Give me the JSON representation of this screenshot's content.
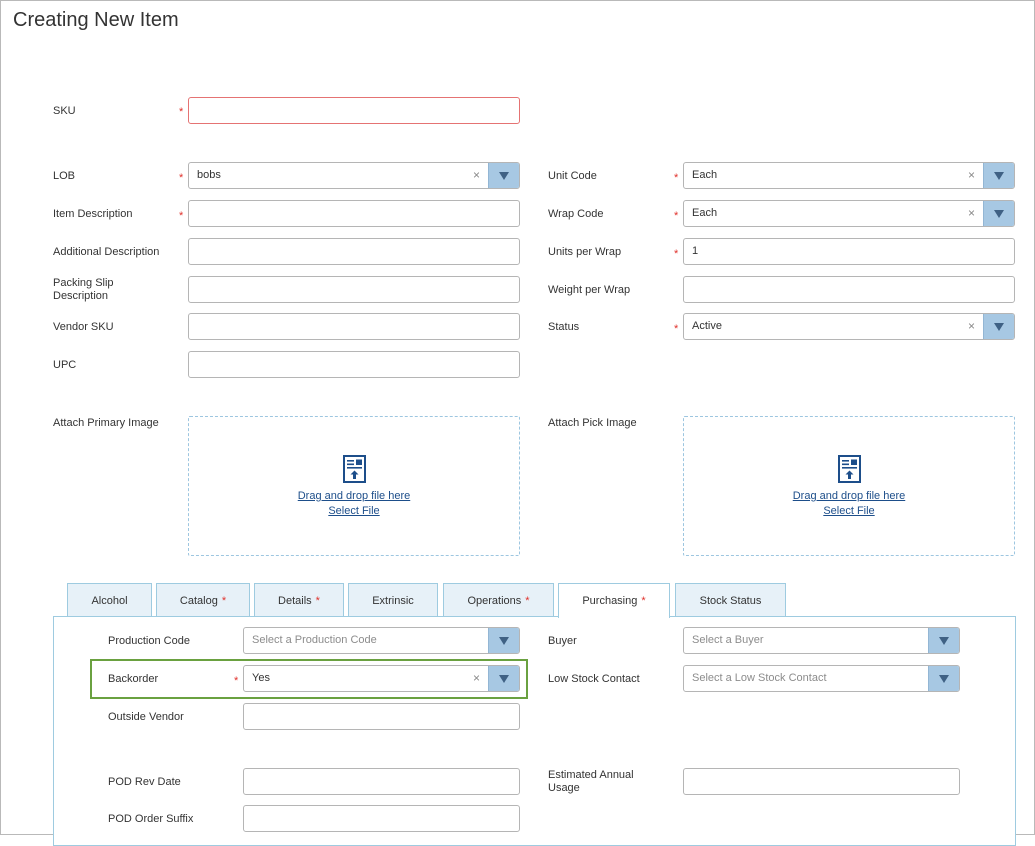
{
  "title": "Creating New Item",
  "form": {
    "sku": {
      "label": "SKU",
      "value": ""
    },
    "lob": {
      "label": "LOB",
      "value": "bobs"
    },
    "item_description": {
      "label": "Item Description",
      "value": ""
    },
    "additional_description": {
      "label": "Additional Description",
      "value": ""
    },
    "packing_slip_description": {
      "label": "Packing Slip Description",
      "value": ""
    },
    "vendor_sku": {
      "label": "Vendor SKU",
      "value": ""
    },
    "upc": {
      "label": "UPC",
      "value": ""
    },
    "unit_code": {
      "label": "Unit Code",
      "value": "Each"
    },
    "wrap_code": {
      "label": "Wrap Code",
      "value": "Each"
    },
    "units_per_wrap": {
      "label": "Units per Wrap",
      "value": "1"
    },
    "weight_per_wrap": {
      "label": "Weight per Wrap",
      "value": ""
    },
    "status": {
      "label": "Status",
      "value": "Active"
    }
  },
  "attach": {
    "primary_label": "Attach Primary Image",
    "pick_label": "Attach Pick Image",
    "drag_text": "Drag and drop file here",
    "select_text": "Select File"
  },
  "tabs": [
    {
      "label": "Alcohol",
      "required": false,
      "active": false
    },
    {
      "label": "Catalog",
      "required": true,
      "active": false
    },
    {
      "label": "Details",
      "required": true,
      "active": false
    },
    {
      "label": "Extrinsic",
      "required": false,
      "active": false
    },
    {
      "label": "Operations",
      "required": true,
      "active": false
    },
    {
      "label": "Purchasing",
      "required": true,
      "active": true
    },
    {
      "label": "Stock Status",
      "required": false,
      "active": false
    }
  ],
  "required_marker": "*",
  "purchasing": {
    "production_code": {
      "label": "Production Code",
      "placeholder": "Select a Production Code"
    },
    "backorder": {
      "label": "Backorder",
      "value": "Yes"
    },
    "outside_vendor": {
      "label": "Outside Vendor",
      "value": ""
    },
    "pod_rev_date": {
      "label": "POD Rev Date",
      "value": ""
    },
    "pod_order_suffix": {
      "label": "POD Order Suffix",
      "value": ""
    },
    "buyer": {
      "label": "Buyer",
      "placeholder": "Select a Buyer"
    },
    "low_stock_contact": {
      "label": "Low Stock Contact",
      "placeholder": "Select a Low Stock Contact"
    },
    "estimated_annual_usage": {
      "label": "Estimated Annual Usage",
      "value": ""
    }
  },
  "colors": {
    "accent_arrow": "#a7c8e3",
    "required": "#e0302a",
    "link": "#1d4e8a",
    "highlight": "#6aa140",
    "tab_border": "#9ecbe0"
  },
  "icons": {
    "clear": "×",
    "dropdown": "chevron-down-icon",
    "file": "file-upload-icon"
  }
}
